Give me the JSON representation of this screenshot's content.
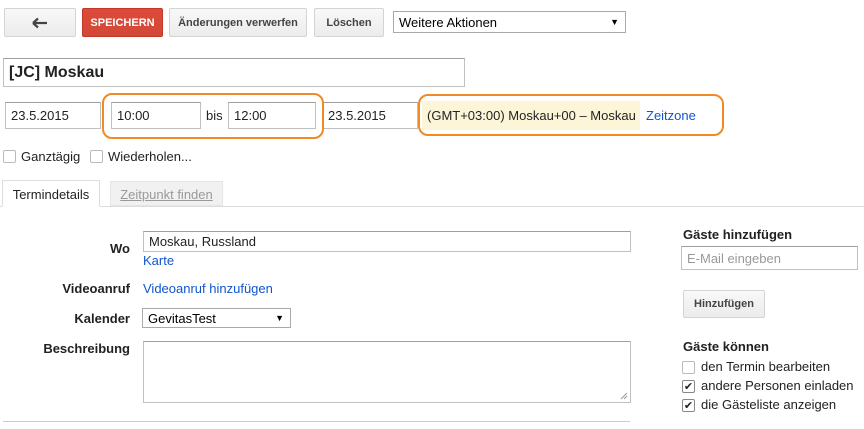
{
  "toolbar": {
    "back_icon": "back-arrow-icon",
    "save_label": "SPEICHERN",
    "discard_label": "Änderungen verwerfen",
    "delete_label": "Löschen",
    "more_actions_value": "Weitere Aktionen"
  },
  "event": {
    "title": "[JC] Moskau",
    "start_date": "23.5.2015",
    "start_time": "10:00",
    "to_label": "bis",
    "end_time": "12:00",
    "end_date": "23.5.2015",
    "timezone": "(GMT+03:00) Moskau+00 – Moskau",
    "timezone_link": "Zeitzone",
    "all_day_label": "Ganztägig",
    "repeat_label": "Wiederholen..."
  },
  "tabs": [
    {
      "label": "Termindetails"
    },
    {
      "label": "Zeitpunkt finden"
    }
  ],
  "details": {
    "where_label": "Wo",
    "where_value": "Moskau, Russland",
    "map_link": "Karte",
    "video_label": "Videoanruf",
    "video_link": "Videoanruf hinzufügen",
    "calendar_label": "Kalender",
    "calendar_value": "GevitasTest",
    "description_label": "Beschreibung",
    "description_value": ""
  },
  "guests": {
    "heading": "Gäste hinzufügen",
    "email_placeholder": "E-Mail eingeben",
    "add_button": "Hinzufügen",
    "can_heading": "Gäste können",
    "permissions": [
      {
        "label": "den Termin bearbeiten",
        "checked": false
      },
      {
        "label": "andere Personen einladen",
        "checked": true
      },
      {
        "label": "die Gästeliste anzeigen",
        "checked": true
      }
    ]
  },
  "colors": {
    "save_button": "#d14836",
    "link": "#1155cc",
    "highlight_outline": "#f08a24",
    "timezone_bg": "#fdf5d8"
  }
}
